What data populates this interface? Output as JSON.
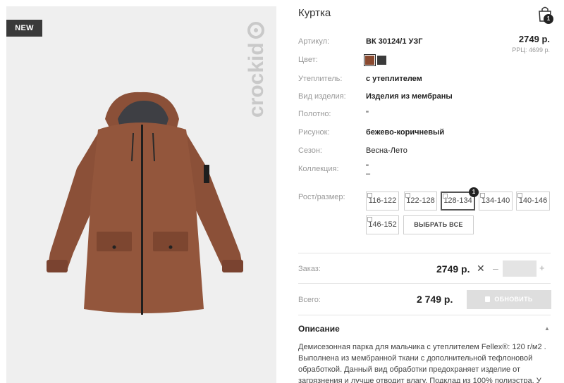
{
  "product": {
    "badge": "NEW",
    "brand": "crockid",
    "title": "Куртка"
  },
  "cart": {
    "count": "1"
  },
  "attributes": [
    {
      "label": "Артикул:",
      "value": "ВК 30124/1 УЗГ"
    },
    {
      "label": "Цвет:",
      "value": ""
    },
    {
      "label": "Утеплитель:",
      "value": "с утеплителем"
    },
    {
      "label": "Вид изделия:",
      "value": "Изделия из мембраны"
    },
    {
      "label": "Полотно:",
      "value": "\""
    },
    {
      "label": "Рисунок:",
      "value": "бежево-коричневый"
    },
    {
      "label": "Сезон:",
      "value": "Весна-Лето"
    },
    {
      "label": "Коллекция:",
      "value": "\""
    },
    {
      "label": "Коллекция:",
      "value_extra": "–"
    }
  ],
  "price": {
    "current": "2749 р.",
    "rrp": "РРЦ: 4699 р."
  },
  "colors": [
    "#8a4a30",
    "#3b3b3b"
  ],
  "sizes": {
    "label": "Рост/размер:",
    "items": [
      "116-122",
      "122-128",
      "128-134",
      "134-140",
      "140-146",
      "146-152"
    ],
    "selected": "128-134",
    "selected_count": "1",
    "select_all": "ВЫБРАТЬ ВСЕ"
  },
  "order": {
    "label": "Заказ:",
    "price": "2749 р.",
    "times": "✕",
    "minus": "–",
    "plus": "+",
    "quantity": ""
  },
  "total": {
    "label": "Всего:",
    "price": "2 749 р.",
    "button": "ОБНОВИТЬ"
  },
  "description": {
    "title": "Описание",
    "caret": "▲",
    "text": "Демисезонная парка для мальчика с утеплителем Fellex®: 120 г/м2 . Выполнена из мембранной ткани с дополнительной тефлоновой обработкой. Данный вид обработки предохраняет изделие от загрязнения и лучше отводит влагу. Подклад из 100% полиэстра. У"
  }
}
